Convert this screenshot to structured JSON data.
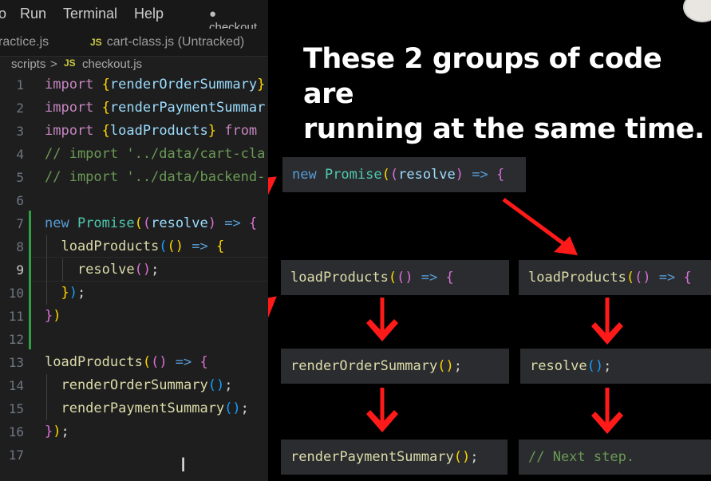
{
  "menubar": {
    "items": [
      "o",
      "Run",
      "Terminal",
      "Help"
    ],
    "active_file": "● checkout."
  },
  "tabs": [
    {
      "label": "ractice.js"
    },
    {
      "badge": "JS",
      "label": "cart-class.js (Untracked)"
    }
  ],
  "breadcrumb": {
    "folder": "scripts",
    "separator": ">",
    "badge": "JS",
    "file": "checkout.js"
  },
  "code": {
    "line_numbers": [
      "1",
      "2",
      "3",
      "4",
      "5",
      "6",
      "7",
      "8",
      "9",
      "10",
      "11",
      "12",
      "13",
      "14",
      "15",
      "16",
      "17"
    ],
    "active_line": "9",
    "lines": [
      [
        {
          "c": "kw",
          "t": "import "
        },
        {
          "c": "br",
          "t": "{"
        },
        {
          "c": "id",
          "t": "renderOrderSummary"
        },
        {
          "c": "br",
          "t": "}"
        }
      ],
      [
        {
          "c": "kw",
          "t": "import "
        },
        {
          "c": "br",
          "t": "{"
        },
        {
          "c": "id",
          "t": "renderPaymentSummar"
        }
      ],
      [
        {
          "c": "kw",
          "t": "import "
        },
        {
          "c": "br",
          "t": "{"
        },
        {
          "c": "id",
          "t": "loadProducts"
        },
        {
          "c": "br",
          "t": "}"
        },
        {
          "c": "kw",
          "t": " from"
        }
      ],
      [
        {
          "c": "cm",
          "t": "// import '../data/cart-cla"
        }
      ],
      [
        {
          "c": "cm",
          "t": "// import '../data/backend-"
        }
      ],
      [],
      [
        {
          "c": "op",
          "t": "new "
        },
        {
          "c": "cls",
          "t": "Promise"
        },
        {
          "c": "br",
          "t": "("
        },
        {
          "c": "br2",
          "t": "("
        },
        {
          "c": "id",
          "t": "resolve"
        },
        {
          "c": "br2",
          "t": ")"
        },
        {
          "c": "op",
          "t": " => "
        },
        {
          "c": "br2",
          "t": "{"
        }
      ],
      [
        {
          "c": "fn",
          "t": "  loadProducts"
        },
        {
          "c": "br3",
          "t": "("
        },
        {
          "c": "br",
          "t": "()"
        },
        {
          "c": "op",
          "t": " => "
        },
        {
          "c": "br",
          "t": "{"
        }
      ],
      [
        {
          "c": "fn",
          "t": "    resolve"
        },
        {
          "c": "br2",
          "t": "()"
        },
        {
          "c": "pl",
          "t": ";"
        }
      ],
      [
        {
          "c": "br",
          "t": "  }"
        },
        {
          "c": "br3",
          "t": ")"
        },
        {
          "c": "pl",
          "t": ";"
        }
      ],
      [
        {
          "c": "br2",
          "t": "}"
        },
        {
          "c": "br",
          "t": ")"
        }
      ],
      [],
      [
        {
          "c": "fn",
          "t": "loadProducts"
        },
        {
          "c": "br",
          "t": "("
        },
        {
          "c": "br2",
          "t": "()"
        },
        {
          "c": "op",
          "t": " => "
        },
        {
          "c": "br2",
          "t": "{"
        }
      ],
      [
        {
          "c": "fn",
          "t": "  renderOrderSummary"
        },
        {
          "c": "br3",
          "t": "()"
        },
        {
          "c": "pl",
          "t": ";"
        }
      ],
      [
        {
          "c": "fn",
          "t": "  renderPaymentSummary"
        },
        {
          "c": "br3",
          "t": "()"
        },
        {
          "c": "pl",
          "t": ";"
        }
      ],
      [
        {
          "c": "br2",
          "t": "}"
        },
        {
          "c": "br",
          "t": ")"
        },
        {
          "c": "pl",
          "t": ";"
        }
      ],
      []
    ]
  },
  "slide": {
    "headline_line1": "These 2 groups of code are",
    "headline_line2": "running at the same time.",
    "boxes": {
      "promise": [
        {
          "c": "op",
          "t": "new "
        },
        {
          "c": "cls",
          "t": "Promise"
        },
        {
          "c": "br",
          "t": "("
        },
        {
          "c": "br2",
          "t": "("
        },
        {
          "c": "id",
          "t": "resolve"
        },
        {
          "c": "br2",
          "t": ")"
        },
        {
          "c": "op",
          "t": " => "
        },
        {
          "c": "br2",
          "t": "{"
        }
      ],
      "load_left": [
        {
          "c": "fn",
          "t": "loadProducts"
        },
        {
          "c": "br",
          "t": "("
        },
        {
          "c": "br2",
          "t": "()"
        },
        {
          "c": "op",
          "t": " => "
        },
        {
          "c": "br2",
          "t": "{"
        }
      ],
      "load_right": [
        {
          "c": "fn",
          "t": "loadProducts"
        },
        {
          "c": "br",
          "t": "("
        },
        {
          "c": "br2",
          "t": "()"
        },
        {
          "c": "op",
          "t": " => "
        },
        {
          "c": "br2",
          "t": "{"
        }
      ],
      "order": [
        {
          "c": "fn",
          "t": "renderOrderSummary"
        },
        {
          "c": "br",
          "t": "()"
        },
        {
          "c": "pl",
          "t": ";"
        }
      ],
      "resolve": [
        {
          "c": "fn",
          "t": "resolve"
        },
        {
          "c": "br3",
          "t": "()"
        },
        {
          "c": "pl",
          "t": ";"
        }
      ],
      "payment": [
        {
          "c": "fn",
          "t": "renderPaymentSummary"
        },
        {
          "c": "br",
          "t": "()"
        },
        {
          "c": "pl",
          "t": ";"
        }
      ],
      "next": [
        {
          "c": "cm",
          "t": "// Next step."
        }
      ]
    }
  },
  "colors": {
    "arrow": "#ff1a1a",
    "slide_bg": "#000000",
    "box_bg": "#2b2c2f"
  }
}
